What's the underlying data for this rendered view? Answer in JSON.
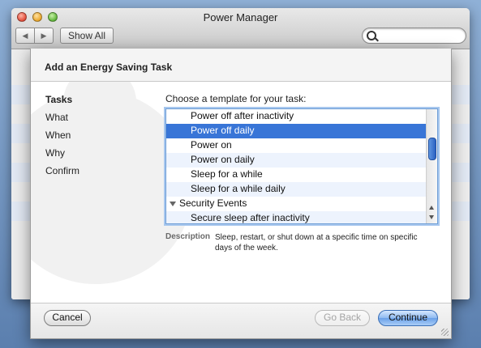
{
  "window": {
    "title": "Power Manager",
    "nav_back": "◀",
    "nav_forward": "▶",
    "show_all": "Show All",
    "search_placeholder": ""
  },
  "sheet": {
    "title": "Add an Energy Saving Task",
    "steps": [
      "Tasks",
      "What",
      "When",
      "Why",
      "Confirm"
    ],
    "active_step": "Tasks",
    "prompt": "Choose a template for your task:",
    "list": [
      {
        "label": "Power off after inactivity",
        "type": "item",
        "selected": false
      },
      {
        "label": "Power off daily",
        "type": "item",
        "selected": true
      },
      {
        "label": "Power on",
        "type": "item",
        "selected": false
      },
      {
        "label": "Power on daily",
        "type": "item",
        "selected": false
      },
      {
        "label": "Sleep for a while",
        "type": "item",
        "selected": false
      },
      {
        "label": "Sleep for a while daily",
        "type": "item",
        "selected": false
      },
      {
        "label": "Security Events",
        "type": "group",
        "selected": false
      },
      {
        "label": "Secure sleep after inactivity",
        "type": "item",
        "selected": false
      }
    ],
    "description_label": "Description",
    "description": "Sleep, restart, or shut down at a specific time on specific days of the week.",
    "buttons": {
      "cancel": "Cancel",
      "back": "Go Back",
      "continue": "Continue"
    }
  },
  "colors": {
    "selection": "#3875d7",
    "alternate_row": "#edf3fd",
    "default_button": "#6aa0e8"
  }
}
